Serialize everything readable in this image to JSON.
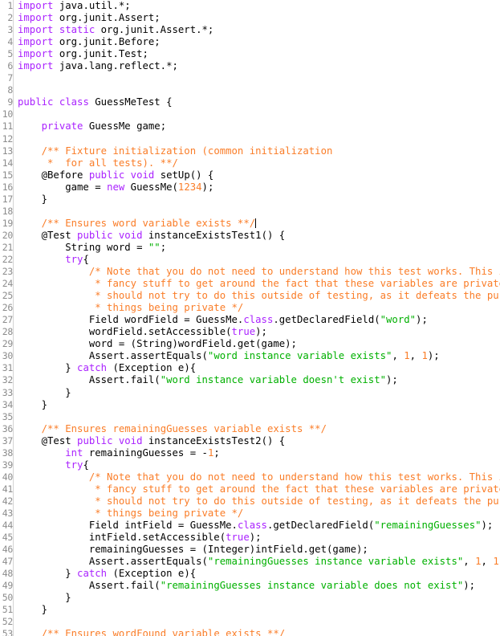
{
  "editor": {
    "file_name": "GuessMeTest.java",
    "language": "java",
    "colors": {
      "background": "#ffffff",
      "gutter_text": "#8c8c8c",
      "gutter_separator": "#d4d4d4",
      "plain_text": "#000000",
      "keyword": "#aa22ff",
      "string": "#00b000",
      "comment": "#fa7d28",
      "number": "#fa7d28",
      "caret": "#000000"
    },
    "first_visible_line": 1,
    "last_visible_line": 53,
    "caret_line": 19,
    "caret_column": 36
  },
  "lines": [
    {
      "n": "1",
      "tokens": [
        {
          "t": "import",
          "c": "kw"
        },
        {
          "t": " java.util.*;",
          "c": "pln"
        }
      ]
    },
    {
      "n": "2",
      "tokens": [
        {
          "t": "import",
          "c": "kw"
        },
        {
          "t": " org.junit.Assert;",
          "c": "pln"
        }
      ]
    },
    {
      "n": "3",
      "tokens": [
        {
          "t": "import",
          "c": "kw"
        },
        {
          "t": " ",
          "c": "pln"
        },
        {
          "t": "static",
          "c": "kw"
        },
        {
          "t": " org.junit.Assert.*;",
          "c": "pln"
        }
      ]
    },
    {
      "n": "4",
      "tokens": [
        {
          "t": "import",
          "c": "kw"
        },
        {
          "t": " org.junit.Before;",
          "c": "pln"
        }
      ]
    },
    {
      "n": "5",
      "tokens": [
        {
          "t": "import",
          "c": "kw"
        },
        {
          "t": " org.junit.Test;",
          "c": "pln"
        }
      ]
    },
    {
      "n": "6",
      "tokens": [
        {
          "t": "import",
          "c": "kw"
        },
        {
          "t": " java.lang.reflect.*;",
          "c": "pln"
        }
      ]
    },
    {
      "n": "7",
      "tokens": []
    },
    {
      "n": "8",
      "tokens": []
    },
    {
      "n": "9",
      "tokens": [
        {
          "t": "public",
          "c": "kw"
        },
        {
          "t": " ",
          "c": "pln"
        },
        {
          "t": "class",
          "c": "kw"
        },
        {
          "t": " GuessMeTest {",
          "c": "pln"
        }
      ]
    },
    {
      "n": "10",
      "tokens": []
    },
    {
      "n": "11",
      "tokens": [
        {
          "t": "    ",
          "c": "pln"
        },
        {
          "t": "private",
          "c": "kw"
        },
        {
          "t": " GuessMe game;",
          "c": "pln"
        }
      ]
    },
    {
      "n": "12",
      "tokens": []
    },
    {
      "n": "13",
      "tokens": [
        {
          "t": "    ",
          "c": "pln"
        },
        {
          "t": "/** Fixture initialization (common initialization",
          "c": "cmt"
        }
      ]
    },
    {
      "n": "14",
      "tokens": [
        {
          "t": "     *  for all tests). **/",
          "c": "cmt"
        }
      ]
    },
    {
      "n": "15",
      "tokens": [
        {
          "t": "    @Before",
          "c": "ann"
        },
        {
          "t": " ",
          "c": "pln"
        },
        {
          "t": "public",
          "c": "kw"
        },
        {
          "t": " ",
          "c": "pln"
        },
        {
          "t": "void",
          "c": "kw"
        },
        {
          "t": " setUp() {",
          "c": "pln"
        }
      ]
    },
    {
      "n": "16",
      "tokens": [
        {
          "t": "        game = ",
          "c": "pln"
        },
        {
          "t": "new",
          "c": "kw"
        },
        {
          "t": " GuessMe(",
          "c": "pln"
        },
        {
          "t": "1234",
          "c": "num"
        },
        {
          "t": ");",
          "c": "pln"
        }
      ]
    },
    {
      "n": "17",
      "tokens": [
        {
          "t": "    }",
          "c": "pln"
        }
      ]
    },
    {
      "n": "18",
      "tokens": []
    },
    {
      "n": "19",
      "tokens": [
        {
          "t": "    ",
          "c": "pln"
        },
        {
          "t": "/** Ensures word variable exists **/",
          "c": "cmt"
        },
        {
          "t": "",
          "c": "caret"
        }
      ]
    },
    {
      "n": "20",
      "tokens": [
        {
          "t": "    @Test",
          "c": "ann"
        },
        {
          "t": " ",
          "c": "pln"
        },
        {
          "t": "public",
          "c": "kw"
        },
        {
          "t": " ",
          "c": "pln"
        },
        {
          "t": "void",
          "c": "kw"
        },
        {
          "t": " instanceExistsTest1() {",
          "c": "pln"
        }
      ]
    },
    {
      "n": "21",
      "tokens": [
        {
          "t": "        String word = ",
          "c": "pln"
        },
        {
          "t": "\"\"",
          "c": "str"
        },
        {
          "t": ";",
          "c": "pln"
        }
      ]
    },
    {
      "n": "22",
      "tokens": [
        {
          "t": "        ",
          "c": "pln"
        },
        {
          "t": "try",
          "c": "kw"
        },
        {
          "t": "{",
          "c": "pln"
        }
      ]
    },
    {
      "n": "23",
      "tokens": [
        {
          "t": "            /* Note that you do not need to understand how this test works. This is some",
          "c": "cmt"
        }
      ]
    },
    {
      "n": "24",
      "tokens": [
        {
          "t": "             * fancy stuff to get around the fact that these variables are private. You",
          "c": "cmt"
        }
      ]
    },
    {
      "n": "25",
      "tokens": [
        {
          "t": "             * should not try to do this outside of testing, as it defeats the purpose of",
          "c": "cmt"
        }
      ]
    },
    {
      "n": "26",
      "tokens": [
        {
          "t": "             * things being private */",
          "c": "cmt"
        }
      ]
    },
    {
      "n": "27",
      "tokens": [
        {
          "t": "            Field wordField = GuessMe.",
          "c": "pln"
        },
        {
          "t": "class",
          "c": "kw"
        },
        {
          "t": ".getDeclaredField(",
          "c": "pln"
        },
        {
          "t": "\"word\"",
          "c": "str"
        },
        {
          "t": ");",
          "c": "pln"
        }
      ]
    },
    {
      "n": "28",
      "tokens": [
        {
          "t": "            wordField.setAccessible(",
          "c": "pln"
        },
        {
          "t": "true",
          "c": "kw"
        },
        {
          "t": ");",
          "c": "pln"
        }
      ]
    },
    {
      "n": "29",
      "tokens": [
        {
          "t": "            word = (String)wordField.get(game);",
          "c": "pln"
        }
      ]
    },
    {
      "n": "30",
      "tokens": [
        {
          "t": "            Assert.assertEquals(",
          "c": "pln"
        },
        {
          "t": "\"word instance variable exists\"",
          "c": "str"
        },
        {
          "t": ", ",
          "c": "pln"
        },
        {
          "t": "1",
          "c": "num"
        },
        {
          "t": ", ",
          "c": "pln"
        },
        {
          "t": "1",
          "c": "num"
        },
        {
          "t": ");",
          "c": "pln"
        }
      ]
    },
    {
      "n": "31",
      "tokens": [
        {
          "t": "        } ",
          "c": "pln"
        },
        {
          "t": "catch",
          "c": "kw"
        },
        {
          "t": " (Exception e){",
          "c": "pln"
        }
      ]
    },
    {
      "n": "32",
      "tokens": [
        {
          "t": "            Assert.fail(",
          "c": "pln"
        },
        {
          "t": "\"word instance variable doesn't exist\"",
          "c": "str"
        },
        {
          "t": ");",
          "c": "pln"
        }
      ]
    },
    {
      "n": "33",
      "tokens": [
        {
          "t": "        }",
          "c": "pln"
        }
      ]
    },
    {
      "n": "34",
      "tokens": [
        {
          "t": "    }",
          "c": "pln"
        }
      ]
    },
    {
      "n": "35",
      "tokens": []
    },
    {
      "n": "36",
      "tokens": [
        {
          "t": "    ",
          "c": "pln"
        },
        {
          "t": "/** Ensures remainingGuesses variable exists **/",
          "c": "cmt"
        }
      ]
    },
    {
      "n": "37",
      "tokens": [
        {
          "t": "    @Test",
          "c": "ann"
        },
        {
          "t": " ",
          "c": "pln"
        },
        {
          "t": "public",
          "c": "kw"
        },
        {
          "t": " ",
          "c": "pln"
        },
        {
          "t": "void",
          "c": "kw"
        },
        {
          "t": " instanceExistsTest2() {",
          "c": "pln"
        }
      ]
    },
    {
      "n": "38",
      "tokens": [
        {
          "t": "        ",
          "c": "pln"
        },
        {
          "t": "int",
          "c": "kw"
        },
        {
          "t": " remainingGuesses = -",
          "c": "pln"
        },
        {
          "t": "1",
          "c": "num"
        },
        {
          "t": ";",
          "c": "pln"
        }
      ]
    },
    {
      "n": "39",
      "tokens": [
        {
          "t": "        ",
          "c": "pln"
        },
        {
          "t": "try",
          "c": "kw"
        },
        {
          "t": "{",
          "c": "pln"
        }
      ]
    },
    {
      "n": "40",
      "tokens": [
        {
          "t": "            /* Note that you do not need to understand how this test works. This is some",
          "c": "cmt"
        }
      ]
    },
    {
      "n": "41",
      "tokens": [
        {
          "t": "             * fancy stuff to get around the fact that these variables are private. You",
          "c": "cmt"
        }
      ]
    },
    {
      "n": "42",
      "tokens": [
        {
          "t": "             * should not try to do this outside of testing, as it defeats the purpose of",
          "c": "cmt"
        }
      ]
    },
    {
      "n": "43",
      "tokens": [
        {
          "t": "             * things being private */",
          "c": "cmt"
        }
      ]
    },
    {
      "n": "44",
      "tokens": [
        {
          "t": "            Field intField = GuessMe.",
          "c": "pln"
        },
        {
          "t": "class",
          "c": "kw"
        },
        {
          "t": ".getDeclaredField(",
          "c": "pln"
        },
        {
          "t": "\"remainingGuesses\"",
          "c": "str"
        },
        {
          "t": ");",
          "c": "pln"
        }
      ]
    },
    {
      "n": "45",
      "tokens": [
        {
          "t": "            intField.setAccessible(",
          "c": "pln"
        },
        {
          "t": "true",
          "c": "kw"
        },
        {
          "t": ");",
          "c": "pln"
        }
      ]
    },
    {
      "n": "46",
      "tokens": [
        {
          "t": "            remainingGuesses = (Integer)intField.get(game);",
          "c": "pln"
        }
      ]
    },
    {
      "n": "47",
      "tokens": [
        {
          "t": "            Assert.assertEquals(",
          "c": "pln"
        },
        {
          "t": "\"remainingGuesses instance variable exists\"",
          "c": "str"
        },
        {
          "t": ", ",
          "c": "pln"
        },
        {
          "t": "1",
          "c": "num"
        },
        {
          "t": ", ",
          "c": "pln"
        },
        {
          "t": "1",
          "c": "num"
        },
        {
          "t": ");",
          "c": "pln"
        }
      ]
    },
    {
      "n": "48",
      "tokens": [
        {
          "t": "        } ",
          "c": "pln"
        },
        {
          "t": "catch",
          "c": "kw"
        },
        {
          "t": " (Exception e){",
          "c": "pln"
        }
      ]
    },
    {
      "n": "49",
      "tokens": [
        {
          "t": "            Assert.fail(",
          "c": "pln"
        },
        {
          "t": "\"remainingGuesses instance variable does not exist\"",
          "c": "str"
        },
        {
          "t": ");",
          "c": "pln"
        }
      ]
    },
    {
      "n": "50",
      "tokens": [
        {
          "t": "        }",
          "c": "pln"
        }
      ]
    },
    {
      "n": "51",
      "tokens": [
        {
          "t": "    }",
          "c": "pln"
        }
      ]
    },
    {
      "n": "52",
      "tokens": []
    },
    {
      "n": "53",
      "tokens": [
        {
          "t": "    ",
          "c": "pln"
        },
        {
          "t": "/** Ensures wordFound variable exists **/",
          "c": "cmt"
        }
      ]
    }
  ]
}
